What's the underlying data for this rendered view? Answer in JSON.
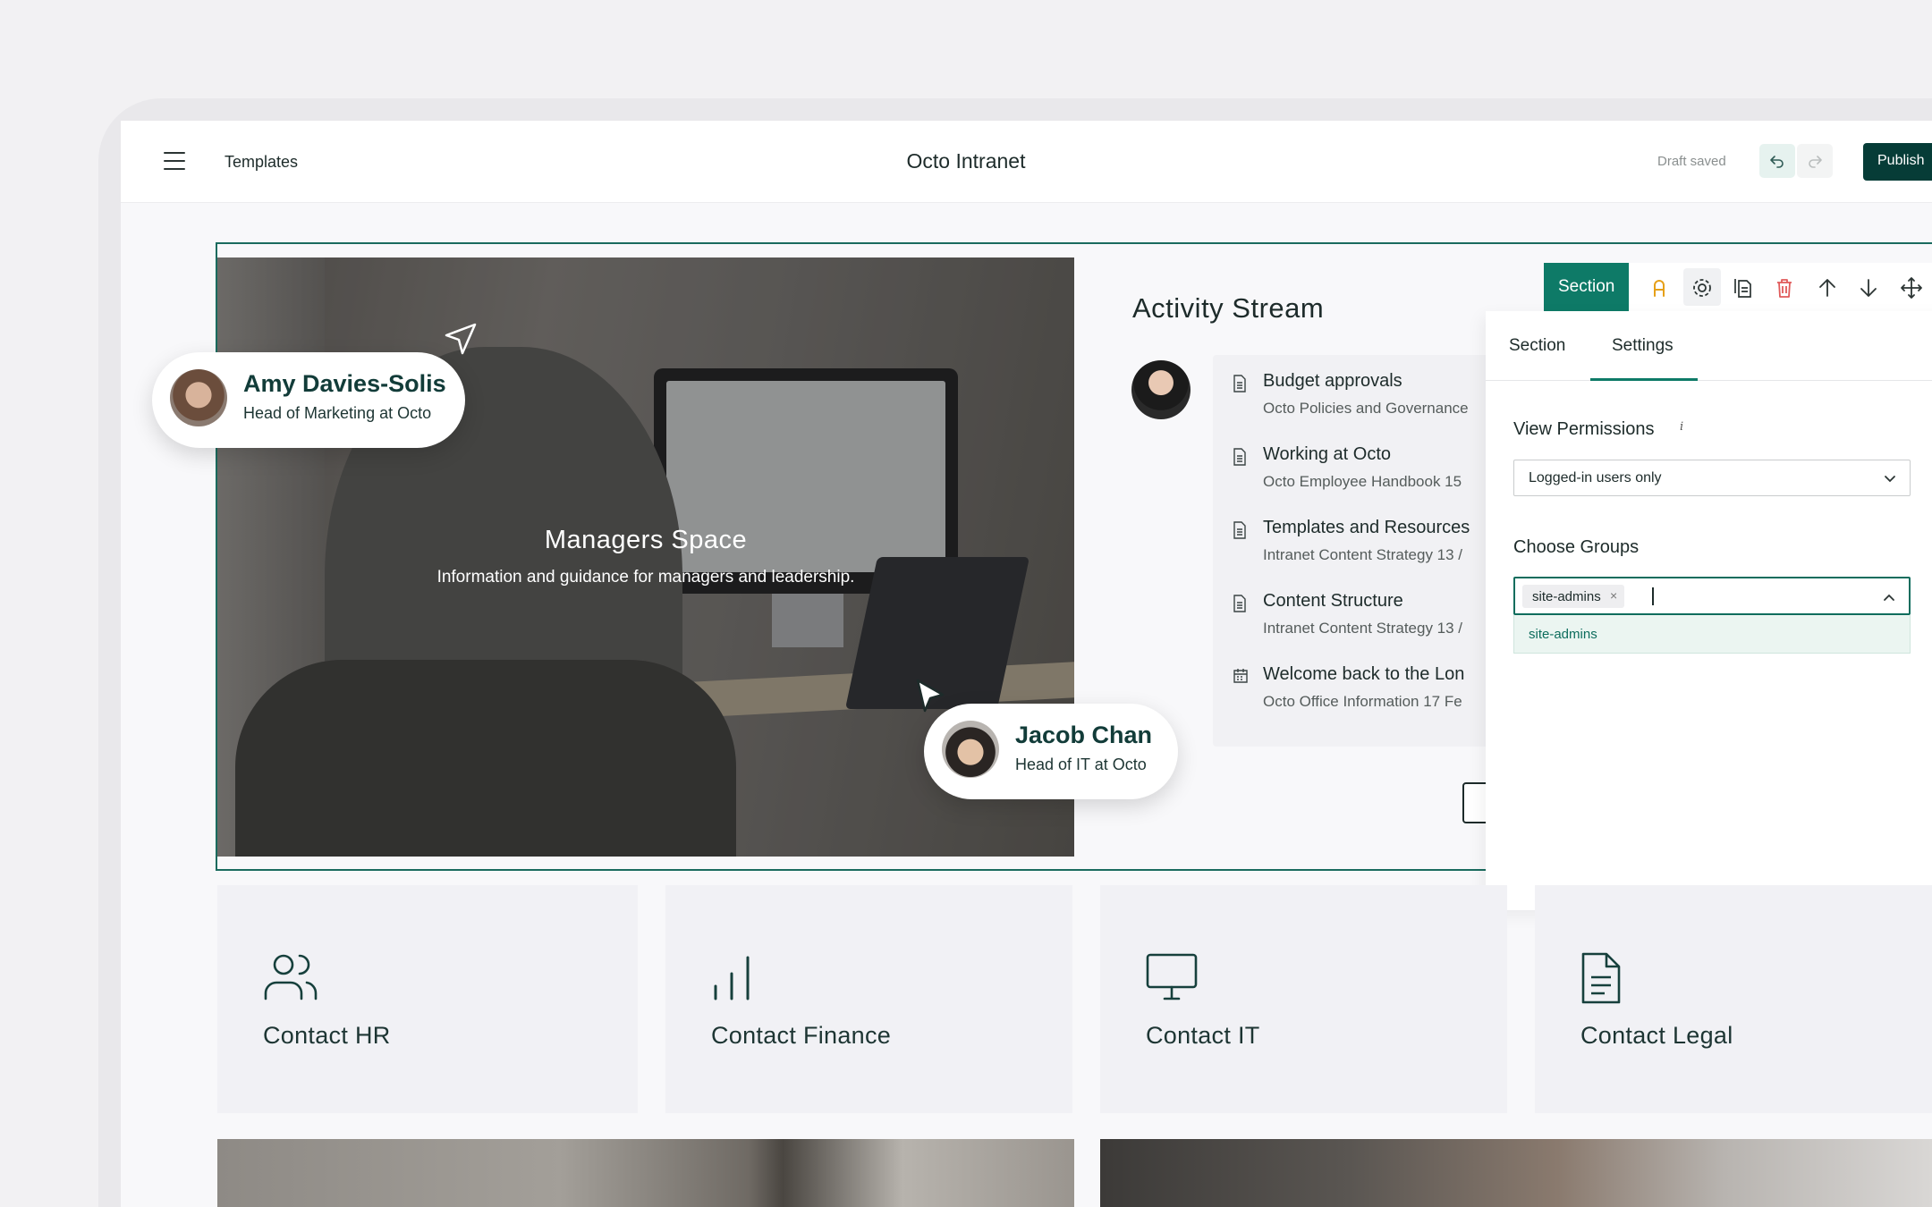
{
  "topbar": {
    "templates_label": "Templates",
    "site_title": "Octo Intranet",
    "status": "Draft saved",
    "publish_label": "Publish"
  },
  "hero": {
    "title": "Managers Space",
    "subtitle": "Information and guidance for managers and leadership."
  },
  "presence": [
    {
      "name": "Amy Davies-Solis",
      "role": "Head of Marketing at Octo"
    },
    {
      "name": "Jacob Chan",
      "role": "Head of IT at Octo"
    }
  ],
  "activity": {
    "title": "Activity Stream",
    "items": [
      {
        "title": "Budget approvals",
        "meta": "Octo Policies and Governance",
        "icon": "document-icon"
      },
      {
        "title": "Working at Octo",
        "meta": "Octo Employee Handbook   15",
        "icon": "document-icon"
      },
      {
        "title": "Templates and Resources",
        "meta": "Intranet Content Strategy   13 /",
        "icon": "document-icon"
      },
      {
        "title": "Content Structure",
        "meta": "Intranet Content Strategy   13 /",
        "icon": "document-icon"
      },
      {
        "title": "Welcome back to the Lon",
        "meta": "Octo Office Information   17 Fe",
        "icon": "calendar-icon"
      }
    ]
  },
  "toolbar": {
    "section_label": "Section",
    "icons": [
      "accessibility-icon",
      "gear-icon",
      "copy-icon",
      "trash-icon",
      "arrow-up-icon",
      "arrow-down-icon",
      "move-icon"
    ]
  },
  "settings": {
    "tabs": [
      "Section",
      "Settings"
    ],
    "active_tab": "Settings",
    "view_permissions_label": "View Permissions",
    "view_permissions_value": "Logged-in users only",
    "choose_groups_label": "Choose Groups",
    "selected_tag": "site-admins",
    "dropdown_option": "site-admins"
  },
  "contacts": [
    "Contact HR",
    "Contact Finance",
    "Contact IT",
    "Contact Legal"
  ],
  "colors": {
    "accent": "#0e7a67",
    "publish": "#063c37",
    "danger": "#e05a5a",
    "warning": "#e6a019"
  }
}
